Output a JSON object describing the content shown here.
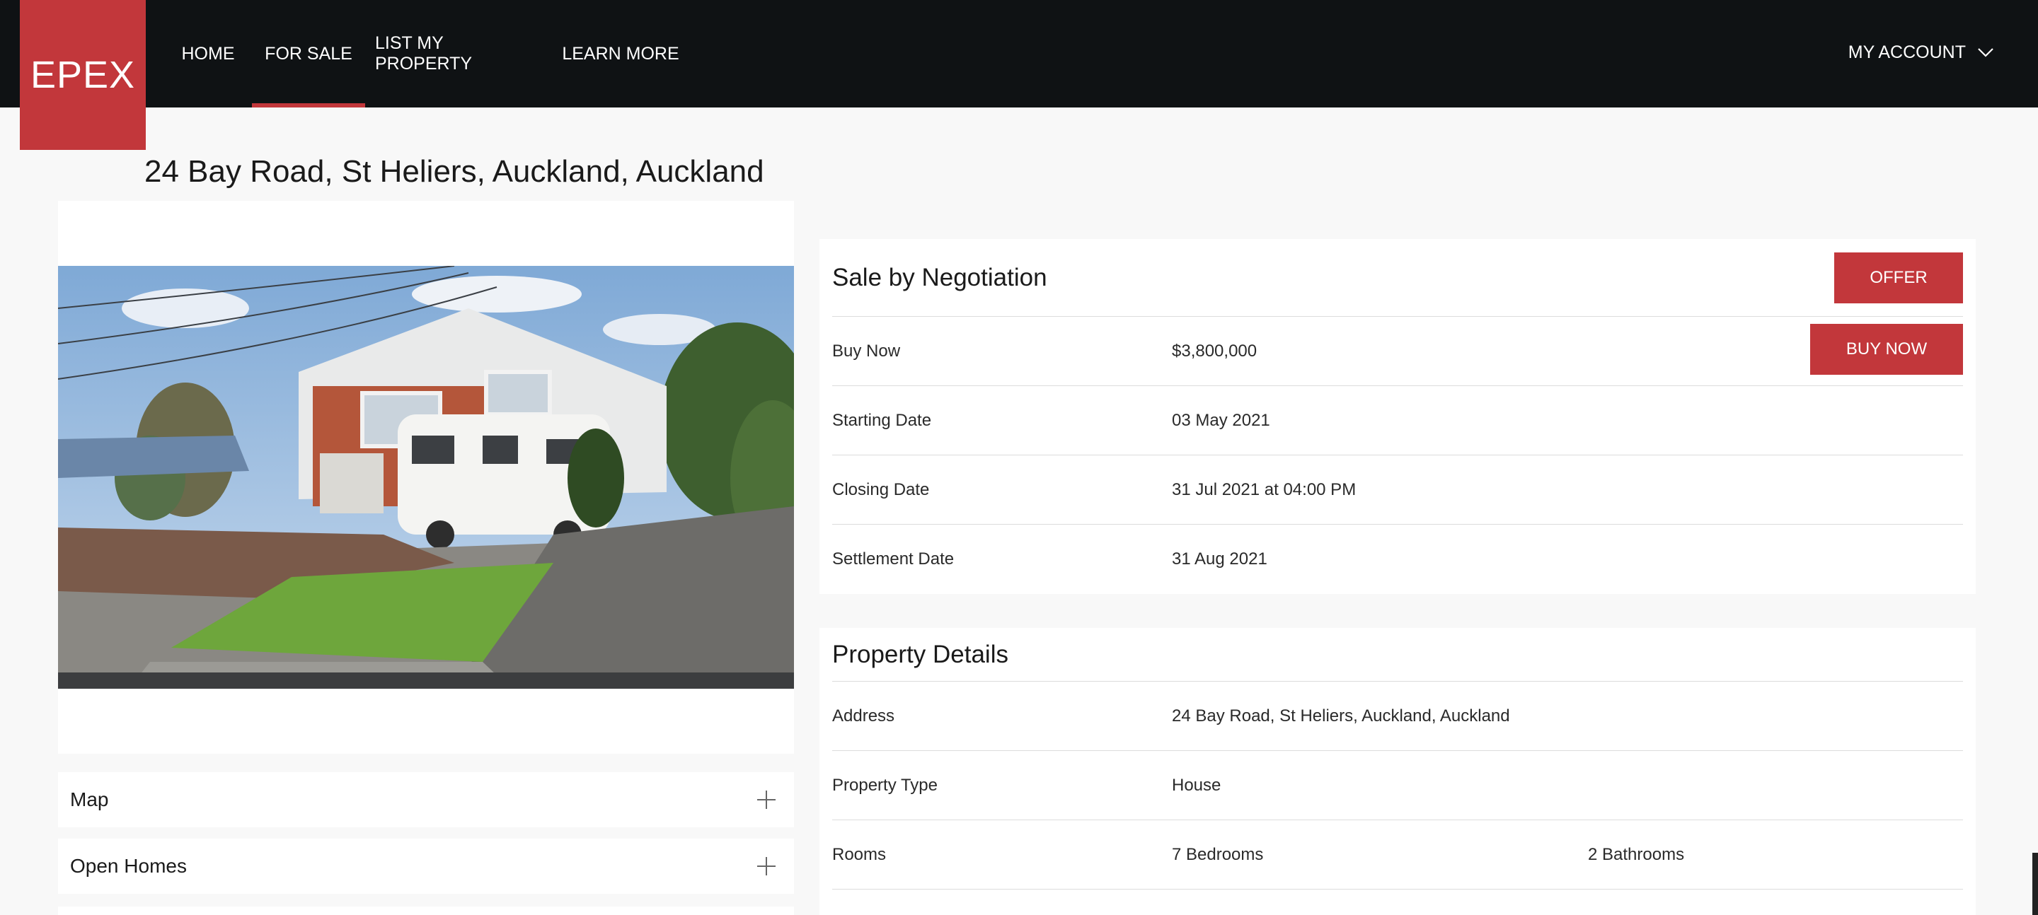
{
  "brand": {
    "logo_text": "EPEX"
  },
  "nav": {
    "items": [
      {
        "label": "HOME"
      },
      {
        "label": "FOR SALE"
      },
      {
        "label": "LIST MY PROPERTY"
      },
      {
        "label": "LEARN MORE"
      }
    ],
    "active": "FOR SALE",
    "account_label": "MY ACCOUNT"
  },
  "listing": {
    "title": "24 Bay Road, St Heliers, Auckland, Auckland"
  },
  "panels": {
    "map_label": "Map",
    "open_homes_label": "Open Homes"
  },
  "sale": {
    "heading": "Sale by Negotiation",
    "offer_button": "OFFER",
    "buy_now_button": "BUY NOW",
    "rows": [
      {
        "label": "Buy Now",
        "value": "$3,800,000"
      },
      {
        "label": "Starting Date",
        "value": "03 May 2021"
      },
      {
        "label": "Closing Date",
        "value": "31 Jul 2021 at 04:00 PM"
      },
      {
        "label": "Settlement Date",
        "value": "31 Aug 2021"
      }
    ]
  },
  "details": {
    "heading": "Property Details",
    "rows": [
      {
        "label": "Address",
        "value": "24 Bay Road, St Heliers, Auckland, Auckland"
      },
      {
        "label": "Property Type",
        "value": "House"
      },
      {
        "label": "Rooms",
        "value": "7 Bedrooms",
        "value2": "2 Bathrooms"
      }
    ]
  },
  "colors": {
    "accent": "#c2373b",
    "nav_bg": "#0f1214",
    "page_bg": "#f8f8f8"
  },
  "icons": {
    "account_dropdown": "chevron-down-icon",
    "expand": "plus-icon"
  }
}
